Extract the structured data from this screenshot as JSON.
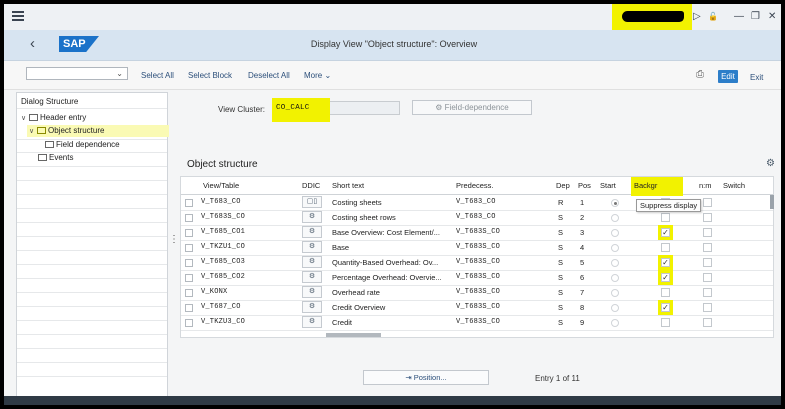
{
  "window": {
    "menu_icon": "hamburger-menu-icon",
    "controls": [
      "play-icon",
      "lock-icon",
      "minimize-icon",
      "restore-icon",
      "close-icon"
    ],
    "controls_glyphs": [
      "▷",
      "🔓",
      "—",
      "❐",
      "✕"
    ]
  },
  "header": {
    "back_glyph": "‹",
    "logo": "SAP",
    "title": "Display View \"Object structure\": Overview"
  },
  "toolbar": {
    "dropdown_value": "",
    "buttons": [
      "Select All",
      "Select Block",
      "Deselect All",
      "More"
    ],
    "more_chevron": "⌄",
    "print_glyph": "⎙",
    "edit_label": "Edit",
    "exit_label": "Exit"
  },
  "dialog_structure": {
    "title": "Dialog Structure",
    "items": [
      {
        "label": "Header entry",
        "level": 0,
        "expanded": true
      },
      {
        "label": "Object structure",
        "level": 1,
        "expanded": true,
        "selected": true
      },
      {
        "label": "Field dependence",
        "level": 2
      },
      {
        "label": "Events",
        "level": 1
      }
    ]
  },
  "view_cluster": {
    "label": "View Cluster:",
    "value": "CO_CALC",
    "field_dependence_label": "Field-dependence",
    "field_dependence_icon": "⚙"
  },
  "object_structure": {
    "title": "Object structure",
    "settings_icon": "⚙",
    "columns": [
      "View/Table",
      "DDIC",
      "Short text",
      "Predecess.",
      "Dep",
      "Pos",
      "Start",
      "Backgr",
      "n:m",
      "Switch"
    ],
    "tooltip": "Suppress display",
    "rows": [
      {
        "view": "V_T683_CO",
        "ddic": "▢▯",
        "short": "Costing sheets",
        "pred": "V_T683_CO",
        "dep": "R",
        "pos": "1",
        "start": true,
        "backgr": false,
        "nm": false
      },
      {
        "view": "V_T683S_CO",
        "ddic": "⚙",
        "short": "Costing sheet rows",
        "pred": "V_T683_CO",
        "dep": "S",
        "pos": "2",
        "start": false,
        "backgr": false,
        "nm": false
      },
      {
        "view": "V_T685_CO1",
        "ddic": "⚙",
        "short": "Base Overview: Cost Element/...",
        "pred": "V_T683S_CO",
        "dep": "S",
        "pos": "3",
        "start": false,
        "backgr": true,
        "nm": false
      },
      {
        "view": "V_TKZU1_CO",
        "ddic": "⚙",
        "short": "Base",
        "pred": "V_T683S_CO",
        "dep": "S",
        "pos": "4",
        "start": false,
        "backgr": false,
        "nm": false
      },
      {
        "view": "V_T685_CO3",
        "ddic": "⚙",
        "short": "Quantity-Based Overhead: Ov...",
        "pred": "V_T683S_CO",
        "dep": "S",
        "pos": "5",
        "start": false,
        "backgr": true,
        "nm": false
      },
      {
        "view": "V_T685_CO2",
        "ddic": "⚙",
        "short": "Percentage Overhead: Overvie...",
        "pred": "V_T683S_CO",
        "dep": "S",
        "pos": "6",
        "start": false,
        "backgr": true,
        "nm": false
      },
      {
        "view": "V_KONX",
        "ddic": "⚙",
        "short": "Overhead rate",
        "pred": "V_T683S_CO",
        "dep": "S",
        "pos": "7",
        "start": false,
        "backgr": false,
        "nm": false
      },
      {
        "view": "V_T687_CO",
        "ddic": "⚙",
        "short": "Credit Overview",
        "pred": "V_T683S_CO",
        "dep": "S",
        "pos": "8",
        "start": false,
        "backgr": true,
        "nm": false
      },
      {
        "view": "V_TKZU3_CO",
        "ddic": "⚙",
        "short": "Credit",
        "pred": "V_T683S_CO",
        "dep": "S",
        "pos": "9",
        "start": false,
        "backgr": false,
        "nm": false
      }
    ]
  },
  "footer": {
    "position_label": "Position...",
    "position_icon": "⇥",
    "entry_text": "Entry 1 of 11"
  },
  "colors": {
    "highlight": "#f2f200",
    "accent": "#2d7ec9",
    "title_bar": "#d7e4f1"
  }
}
